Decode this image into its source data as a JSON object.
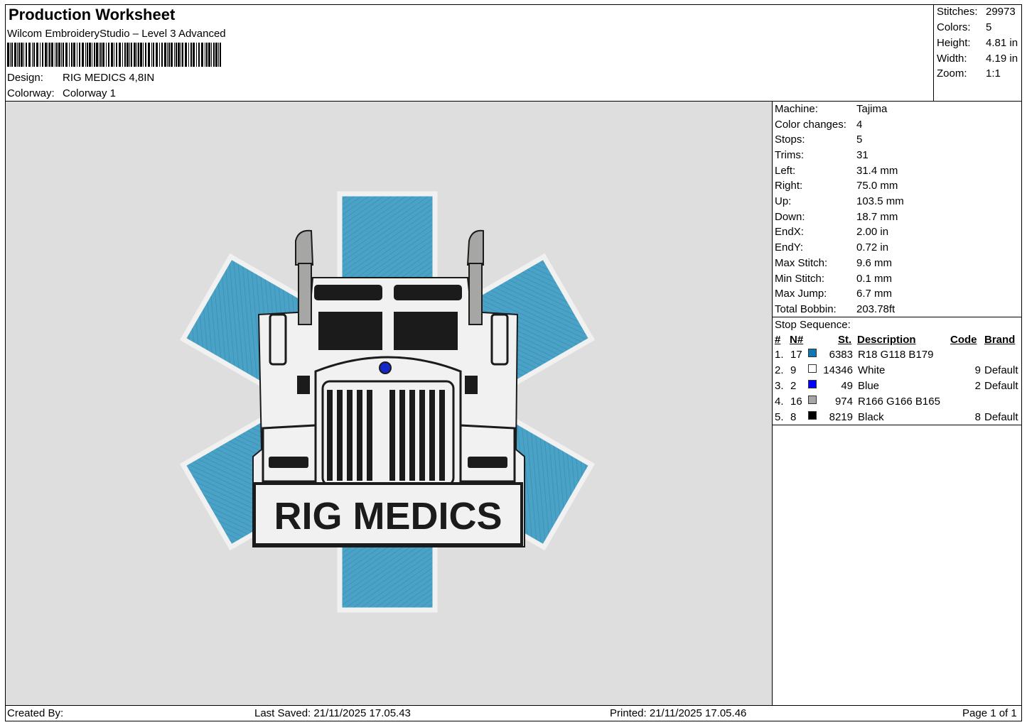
{
  "header": {
    "title": "Production Worksheet",
    "software": "Wilcom EmbroideryStudio – Level 3 Advanced",
    "design_label": "Design:",
    "design_value": "RIG MEDICS 4,8IN",
    "colorway_label": "Colorway:",
    "colorway_value": "Colorway 1"
  },
  "stats": [
    {
      "label": "Stitches:",
      "value": "29973"
    },
    {
      "label": "Colors:",
      "value": "5"
    },
    {
      "label": "Height:",
      "value": "4.81 in"
    },
    {
      "label": "Width:",
      "value": "4.19 in"
    },
    {
      "label": "Zoom:",
      "value": "1:1"
    }
  ],
  "machine_info": [
    {
      "label": "Machine:",
      "value": "Tajima"
    },
    {
      "label": "Color changes:",
      "value": "4"
    },
    {
      "label": "Stops:",
      "value": "5"
    },
    {
      "label": "Trims:",
      "value": "31"
    },
    {
      "label": "Left:",
      "value": "31.4 mm"
    },
    {
      "label": "Right:",
      "value": "75.0 mm"
    },
    {
      "label": "Up:",
      "value": "103.5 mm"
    },
    {
      "label": "Down:",
      "value": "18.7 mm"
    },
    {
      "label": "EndX:",
      "value": "2.00 in"
    },
    {
      "label": "EndY:",
      "value": "0.72 in"
    },
    {
      "label": "Max Stitch:",
      "value": "9.6 mm"
    },
    {
      "label": "Min Stitch:",
      "value": "0.1 mm"
    },
    {
      "label": "Max Jump:",
      "value": "6.7 mm"
    },
    {
      "label": "Total Bobbin:",
      "value": "203.78ft"
    }
  ],
  "stop_sequence": {
    "title": "Stop Sequence:",
    "headers": {
      "index": "#",
      "needle": "N#",
      "stitches": "St.",
      "description": "Description",
      "code": "Code",
      "brand": "Brand"
    },
    "rows": [
      {
        "index": "1.",
        "needle": "17",
        "color": "#1276b3",
        "stitches": "6383",
        "description": "R18 G118 B179",
        "code": "",
        "brand": ""
      },
      {
        "index": "2.",
        "needle": "9",
        "color": "#ffffff",
        "stitches": "14346",
        "description": "White",
        "code": "9",
        "brand": "Default"
      },
      {
        "index": "3.",
        "needle": "2",
        "color": "#0000ff",
        "stitches": "49",
        "description": "Blue",
        "code": "2",
        "brand": "Default"
      },
      {
        "index": "4.",
        "needle": "16",
        "color": "#a6a6a5",
        "stitches": "974",
        "description": "R166 G166 B165",
        "code": "",
        "brand": ""
      },
      {
        "index": "5.",
        "needle": "8",
        "color": "#000000",
        "stitches": "8219",
        "description": "Black",
        "code": "8",
        "brand": "Default"
      }
    ]
  },
  "design_image": {
    "text": "RIG MEDICS",
    "colors": {
      "blue": "#4aa2c6",
      "white": "#f1f1f1",
      "black": "#1b1b1b",
      "gray": "#a6a6a5",
      "gem": "#1428c8",
      "canvas": "#dedede"
    }
  },
  "footer": {
    "created": "Created By:",
    "saved": "Last Saved: 21/11/2025 17.05.43",
    "printed": "Printed: 21/11/2025 17.05.46",
    "page": "Page 1 of 1"
  }
}
